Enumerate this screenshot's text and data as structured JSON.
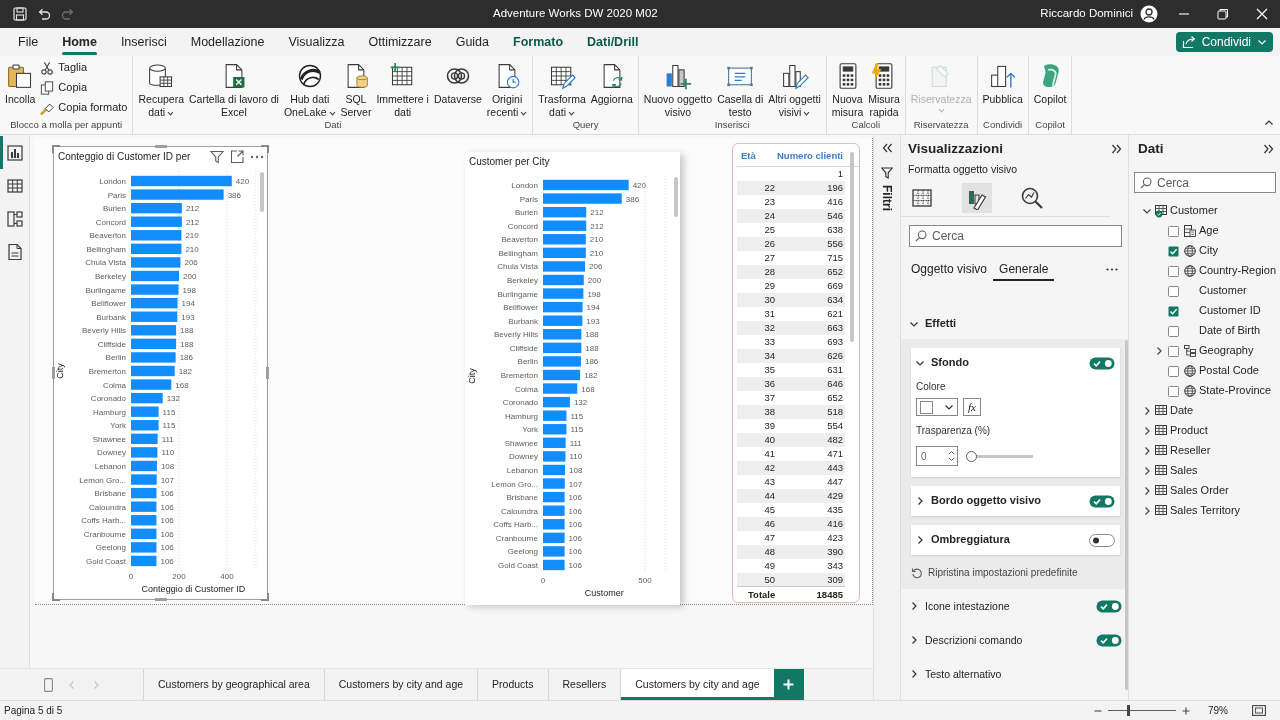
{
  "title_bar": {
    "quick_access": [
      {
        "kind": "save",
        "disabled": false
      },
      {
        "kind": "undo",
        "disabled": false
      },
      {
        "kind": "redo",
        "disabled": true
      }
    ],
    "title": "Adventure Works DW 2020 M02",
    "user": "Riccardo Dominici"
  },
  "menu_tabs": [
    {
      "label": "File",
      "selected": false,
      "contextual": false
    },
    {
      "label": "Home",
      "selected": true,
      "contextual": false
    },
    {
      "label": "Inserisci",
      "selected": false,
      "contextual": false
    },
    {
      "label": "Modellazione",
      "selected": false,
      "contextual": false
    },
    {
      "label": "Visualizza",
      "selected": false,
      "contextual": false
    },
    {
      "label": "Ottimizzare",
      "selected": false,
      "contextual": false
    },
    {
      "label": "Guida",
      "selected": false,
      "contextual": false
    },
    {
      "label": "Formato",
      "selected": false,
      "contextual": true
    },
    {
      "label": "Dati/Drill",
      "selected": false,
      "contextual": true
    }
  ],
  "share_button": "Condividi",
  "ribbon": [
    {
      "label": "Blocco a molla per appunti",
      "buttons": [
        {
          "kind": "paste",
          "label": "Incolla",
          "dropdown": false,
          "disabled": false
        }
      ],
      "small_buttons": [
        {
          "kind": "cut",
          "label": "Taglia",
          "dropdown": false,
          "disabled": false
        },
        {
          "kind": "copy",
          "label": "Copia",
          "dropdown": false,
          "disabled": false
        },
        {
          "kind": "painter",
          "label": "Copia formato",
          "dropdown": false,
          "disabled": false
        }
      ]
    },
    {
      "label": "Dati",
      "buttons": [
        {
          "kind": "database",
          "label": "Recupera\ndati",
          "dropdown": true,
          "disabled": false
        },
        {
          "kind": "excel",
          "label": "Cartella di lavoro di\nExcel",
          "dropdown": false,
          "disabled": false
        },
        {
          "kind": "onelake",
          "label": "Hub dati\nOneLake",
          "dropdown": true,
          "disabled": false
        },
        {
          "kind": "sql",
          "label": "SQL\nServer",
          "dropdown": false,
          "disabled": false
        },
        {
          "kind": "grid",
          "label": "Immettere i\ndati",
          "dropdown": false,
          "disabled": false
        },
        {
          "kind": "dataverse",
          "label": "Dataverse",
          "dropdown": false,
          "disabled": false
        },
        {
          "kind": "recent",
          "label": "Origini\nrecenti",
          "dropdown": true,
          "disabled": false
        }
      ]
    },
    {
      "label": "Query",
      "buttons": [
        {
          "kind": "transform",
          "label": "Trasforma\ndati",
          "dropdown": true,
          "disabled": false
        },
        {
          "kind": "refresh",
          "label": "Aggiorna",
          "dropdown": false,
          "disabled": false
        }
      ]
    },
    {
      "label": "Inserisci",
      "buttons": [
        {
          "kind": "chart",
          "label": "Nuovo oggetto\nvisivo",
          "dropdown": false,
          "disabled": false
        },
        {
          "kind": "textbox",
          "label": "Casella di\ntesto",
          "dropdown": false,
          "disabled": false
        },
        {
          "kind": "visuals",
          "label": "Altri oggetti\nvisivi",
          "dropdown": true,
          "disabled": false
        }
      ]
    },
    {
      "label": "Calcoli",
      "buttons": [
        {
          "kind": "calculator",
          "label": "Nuova\nmisura",
          "dropdown": false,
          "disabled": false
        },
        {
          "kind": "quickcalc",
          "label": "Misura\nrapida",
          "dropdown": false,
          "disabled": false
        }
      ]
    },
    {
      "label": "Riservatezza",
      "buttons": [
        {
          "kind": "sensitivity",
          "label": "Riservatezza",
          "dropdown": true,
          "disabled": true
        }
      ]
    },
    {
      "label": "Condividi",
      "buttons": [
        {
          "kind": "publish",
          "label": "Pubblica",
          "dropdown": false,
          "disabled": false
        }
      ]
    },
    {
      "label": "Copilot",
      "buttons": [
        {
          "kind": "copilot",
          "label": "Copilot",
          "dropdown": false,
          "disabled": false
        }
      ]
    }
  ],
  "nav": [
    {
      "kind": "report",
      "selected": true
    },
    {
      "kind": "table",
      "selected": false
    },
    {
      "kind": "model",
      "selected": false
    },
    {
      "kind": "dax",
      "selected": false
    }
  ],
  "visuals": [
    {
      "kind": "bar_chart",
      "selected": true,
      "chart_data": {
        "type": "bar",
        "orientation": "horizontal",
        "title": "Conteggio di Customer ID per",
        "xlabel": "Conteggio di Customer ID",
        "ylabel": "City",
        "categories": [
          "London",
          "Paris",
          "Burien",
          "Concord",
          "Beaverton",
          "Bellingham",
          "Chula Vista",
          "Berkeley",
          "Burlingame",
          "Bellflower",
          "Burbank",
          "Beverly Hills",
          "Cliffside",
          "Berlin",
          "Bremerton",
          "Colma",
          "Coronado",
          "Hamburg",
          "York",
          "Shawnee",
          "Downey",
          "Lebanon",
          "Lemon Gro...",
          "Brisbane",
          "Caloundra",
          "Coffs Harb...",
          "Cranbourne",
          "Geelong",
          "Gold Coast"
        ],
        "values": [
          420,
          386,
          212,
          212,
          210,
          210,
          206,
          200,
          198,
          194,
          193,
          188,
          188,
          186,
          182,
          168,
          132,
          115,
          115,
          111,
          110,
          108,
          107,
          106,
          106,
          106,
          106,
          106,
          106
        ],
        "xlim": [
          0,
          520
        ],
        "xticks": [
          0,
          200,
          400
        ],
        "data_labels": true
      }
    },
    {
      "kind": "bar_chart",
      "selected": false,
      "chart_data": {
        "type": "bar",
        "orientation": "horizontal",
        "title": "Customer per City",
        "xlabel": "Customer",
        "ylabel": "City",
        "categories": [
          "London",
          "Paris",
          "Burien",
          "Concord",
          "Beaverton",
          "Bellingham",
          "Chula Vista",
          "Berkeley",
          "Burlingame",
          "Bellflower",
          "Burbank",
          "Beverly Hills",
          "Cliffside",
          "Berlin",
          "Bremerton",
          "Colma",
          "Coronado",
          "Hamburg",
          "York",
          "Shawnee",
          "Downey",
          "Lebanon",
          "Lemon Gro...",
          "Brisbane",
          "Caloundra",
          "Coffs Harb...",
          "Cranbourne",
          "Geelong",
          "Gold Coast"
        ],
        "values": [
          420,
          386,
          212,
          212,
          210,
          210,
          206,
          200,
          198,
          194,
          193,
          188,
          188,
          186,
          182,
          168,
          132,
          115,
          115,
          111,
          110,
          108,
          107,
          106,
          106,
          106,
          106,
          106,
          106
        ],
        "xlim": [
          0,
          600
        ],
        "xticks": [
          0,
          500
        ],
        "data_labels": true
      }
    },
    {
      "kind": "table",
      "columns": [
        "Età",
        "Numero clienti"
      ],
      "rows": [
        {
          "numero_clienti": "1"
        },
        {
          "eta": "22",
          "numero_clienti": "196"
        },
        {
          "eta": "23",
          "numero_clienti": "416"
        },
        {
          "eta": "24",
          "numero_clienti": "546"
        },
        {
          "eta": "25",
          "numero_clienti": "638"
        },
        {
          "eta": "26",
          "numero_clienti": "556"
        },
        {
          "eta": "27",
          "numero_clienti": "715"
        },
        {
          "eta": "28",
          "numero_clienti": "652"
        },
        {
          "eta": "29",
          "numero_clienti": "669"
        },
        {
          "eta": "30",
          "numero_clienti": "634"
        },
        {
          "eta": "31",
          "numero_clienti": "621"
        },
        {
          "eta": "32",
          "numero_clienti": "663"
        },
        {
          "eta": "33",
          "numero_clienti": "693"
        },
        {
          "eta": "34",
          "numero_clienti": "626"
        },
        {
          "eta": "35",
          "numero_clienti": "631"
        },
        {
          "eta": "36",
          "numero_clienti": "646"
        },
        {
          "eta": "37",
          "numero_clienti": "652"
        },
        {
          "eta": "38",
          "numero_clienti": "518"
        },
        {
          "eta": "39",
          "numero_clienti": "554"
        },
        {
          "eta": "40",
          "numero_clienti": "482"
        },
        {
          "eta": "41",
          "numero_clienti": "471"
        },
        {
          "eta": "42",
          "numero_clienti": "443"
        },
        {
          "eta": "43",
          "numero_clienti": "447"
        },
        {
          "eta": "44",
          "numero_clienti": "429"
        },
        {
          "eta": "45",
          "numero_clienti": "435"
        },
        {
          "eta": "46",
          "numero_clienti": "416"
        },
        {
          "eta": "47",
          "numero_clienti": "423"
        },
        {
          "eta": "48",
          "numero_clienti": "390"
        },
        {
          "eta": "49",
          "numero_clienti": "343"
        },
        {
          "eta": "50",
          "numero_clienti": "309"
        }
      ],
      "total": {
        "label": "Totale",
        "value": "18485"
      }
    }
  ],
  "page_tabs": [
    {
      "label": "Customers by geographical area",
      "selected": false
    },
    {
      "label": "Customers by city and age",
      "selected": false
    },
    {
      "label": "Products",
      "selected": false
    },
    {
      "label": "Resellers",
      "selected": false
    },
    {
      "label": "Customers by city and age",
      "selected": true
    }
  ],
  "filter_pane": {
    "label": "Filtri"
  },
  "visualizations_pane": {
    "title": "Visualizzazioni",
    "subtitle": "Formatta oggetto visivo",
    "modes": [
      {
        "kind": "build",
        "selected": false
      },
      {
        "kind": "format",
        "selected": true
      },
      {
        "kind": "analytics",
        "selected": false
      }
    ],
    "search": {
      "placeholder": "Cerca"
    },
    "tabs": [
      {
        "label": "Oggetto visivo",
        "selected": false
      },
      {
        "label": "Generale",
        "selected": true
      }
    ],
    "group": {
      "label": "Effetti",
      "expanded": true,
      "cards": [
        {
          "label": "Sfondo",
          "expanded": true,
          "on": true,
          "color_label": "Colore",
          "fx": "fx",
          "transparency_label": "Trasparenza (%)",
          "transparency_value": "0",
          "slider": {
            "level": 0
          }
        },
        {
          "label": "Bordo oggetto visivo",
          "expanded": false,
          "on": true
        },
        {
          "label": "Ombreggiatura",
          "expanded": false,
          "on": false
        }
      ],
      "reset": "Ripristina impostazioni predefinite"
    },
    "sections": [
      {
        "label": "Icone intestazione",
        "expanded": false,
        "on": true
      },
      {
        "label": "Descrizioni comando",
        "expanded": false,
        "on": true
      },
      {
        "label": "Testo alternativo",
        "expanded": false
      }
    ]
  },
  "data_pane": {
    "title": "Dati",
    "search": {
      "placeholder": "Cerca"
    },
    "tables": [
      {
        "name": "Customer",
        "expanded": true,
        "in_use": true,
        "children": [
          {
            "name": "Age",
            "kind": "calculated",
            "checked": false
          },
          {
            "name": "City",
            "kind": "geography",
            "checked": true
          },
          {
            "name": "Country-Region",
            "kind": "geography",
            "checked": false
          },
          {
            "name": "Customer",
            "kind": "field",
            "checked": false
          },
          {
            "name": "Customer ID",
            "kind": "field",
            "checked": true
          },
          {
            "name": "Date of Birth",
            "kind": "field",
            "checked": false
          },
          {
            "name": "Geography",
            "kind": "hierarchy",
            "checked": false,
            "expanded": false
          },
          {
            "name": "Postal Code",
            "kind": "geography",
            "checked": false
          },
          {
            "name": "State-Province",
            "kind": "geography",
            "checked": false
          }
        ]
      },
      {
        "name": "Date",
        "expanded": false,
        "in_use": false
      },
      {
        "name": "Product",
        "expanded": false,
        "in_use": false
      },
      {
        "name": "Reseller",
        "expanded": false,
        "in_use": false
      },
      {
        "name": "Sales",
        "expanded": false,
        "in_use": false
      },
      {
        "name": "Sales Order",
        "expanded": false,
        "in_use": false
      },
      {
        "name": "Sales Territory",
        "expanded": false,
        "in_use": false
      }
    ]
  },
  "status_bar": {
    "page": "Pagina 5 di 5",
    "zoom": "79%",
    "zoom_slider": {
      "level": 0.3
    }
  }
}
